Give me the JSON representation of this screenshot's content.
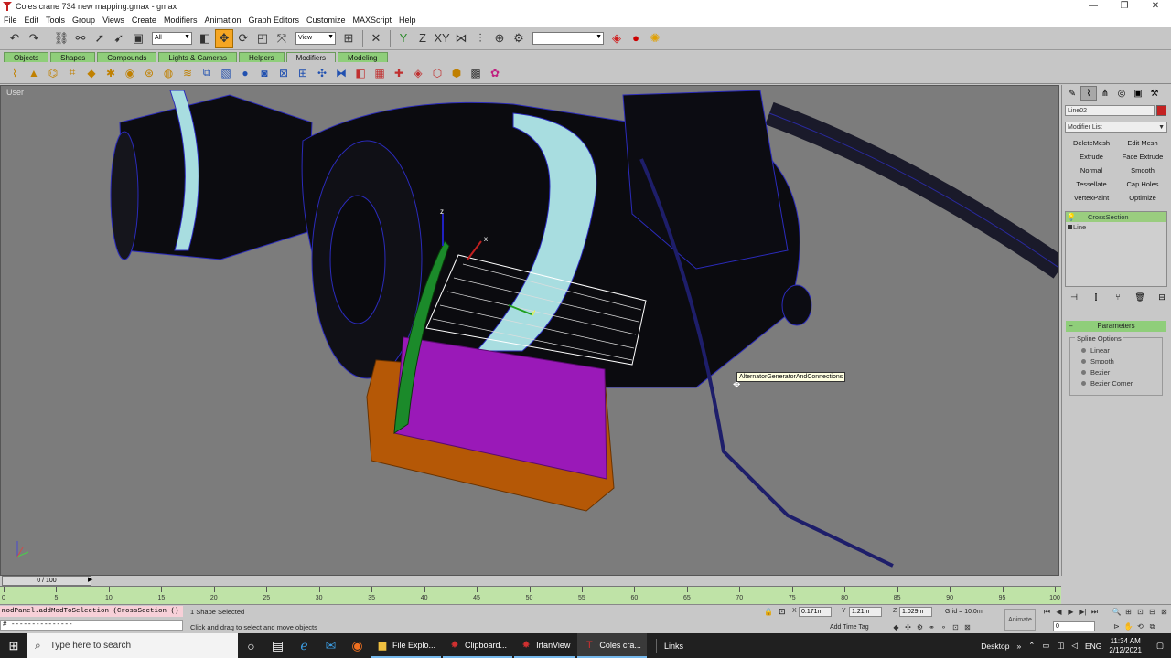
{
  "window": {
    "title": "Coles crane 734 new mapping.gmax - gmax",
    "controls": [
      "—",
      "❐",
      "✕"
    ]
  },
  "menu": [
    "File",
    "Edit",
    "Tools",
    "Group",
    "Views",
    "Create",
    "Modifiers",
    "Animation",
    "Graph Editors",
    "Customize",
    "MAXScript",
    "Help"
  ],
  "toolbar": {
    "selection_filter": "All",
    "ref_coord": "View"
  },
  "tabs": [
    "Objects",
    "Shapes",
    "Compounds",
    "Lights & Cameras",
    "Helpers",
    "Modifiers",
    "Modeling"
  ],
  "active_tab": "Modifiers",
  "viewport": {
    "label": "User",
    "tooltip": "AlternatorGeneratorAndConnections"
  },
  "command_panel": {
    "object_name": "Line02",
    "object_color": "#c42222",
    "modifier_list": "Modifier List",
    "modifier_buttons": [
      "DeleteMesh",
      "Edit Mesh",
      "Extrude",
      "Face Extrude",
      "Normal",
      "Smooth",
      "Tessellate",
      "Cap Holes",
      "VertexPaint",
      "Optimize"
    ],
    "stack": [
      "CrossSection",
      "Line"
    ],
    "rollout": "Parameters",
    "spline_group": "Spline Options",
    "spline_options": [
      "Linear",
      "Smooth",
      "Bezier",
      "Bezier Corner"
    ]
  },
  "timeline": {
    "slider": "0 / 100",
    "ticks": [
      "0",
      "5",
      "10",
      "15",
      "20",
      "25",
      "30",
      "35",
      "40",
      "45",
      "50",
      "55",
      "60",
      "65",
      "70",
      "75",
      "80",
      "85",
      "90",
      "95",
      "100"
    ]
  },
  "status": {
    "maxscript_line1": "modPanel.addModToSelection (CrossSection ()",
    "maxscript_line2": "# ---------------",
    "selected": "1 Shape Selected",
    "prompt": "Click and drag to select and move objects",
    "x": "0.171m",
    "y": "1.21m",
    "z": "1.029m",
    "grid": "Grid = 10.0m",
    "add_time_tag": "Add Time Tag",
    "animate": "Animate",
    "frame": "0"
  },
  "taskbar": {
    "search_placeholder": "Type here to search",
    "apps": [
      "File Explo...",
      "Clipboard...",
      "IrfanView",
      "Coles cra..."
    ],
    "links": "Links",
    "desktop": "Desktop",
    "lang": "ENG",
    "time": "11:34 AM",
    "date": "2/12/2021"
  }
}
